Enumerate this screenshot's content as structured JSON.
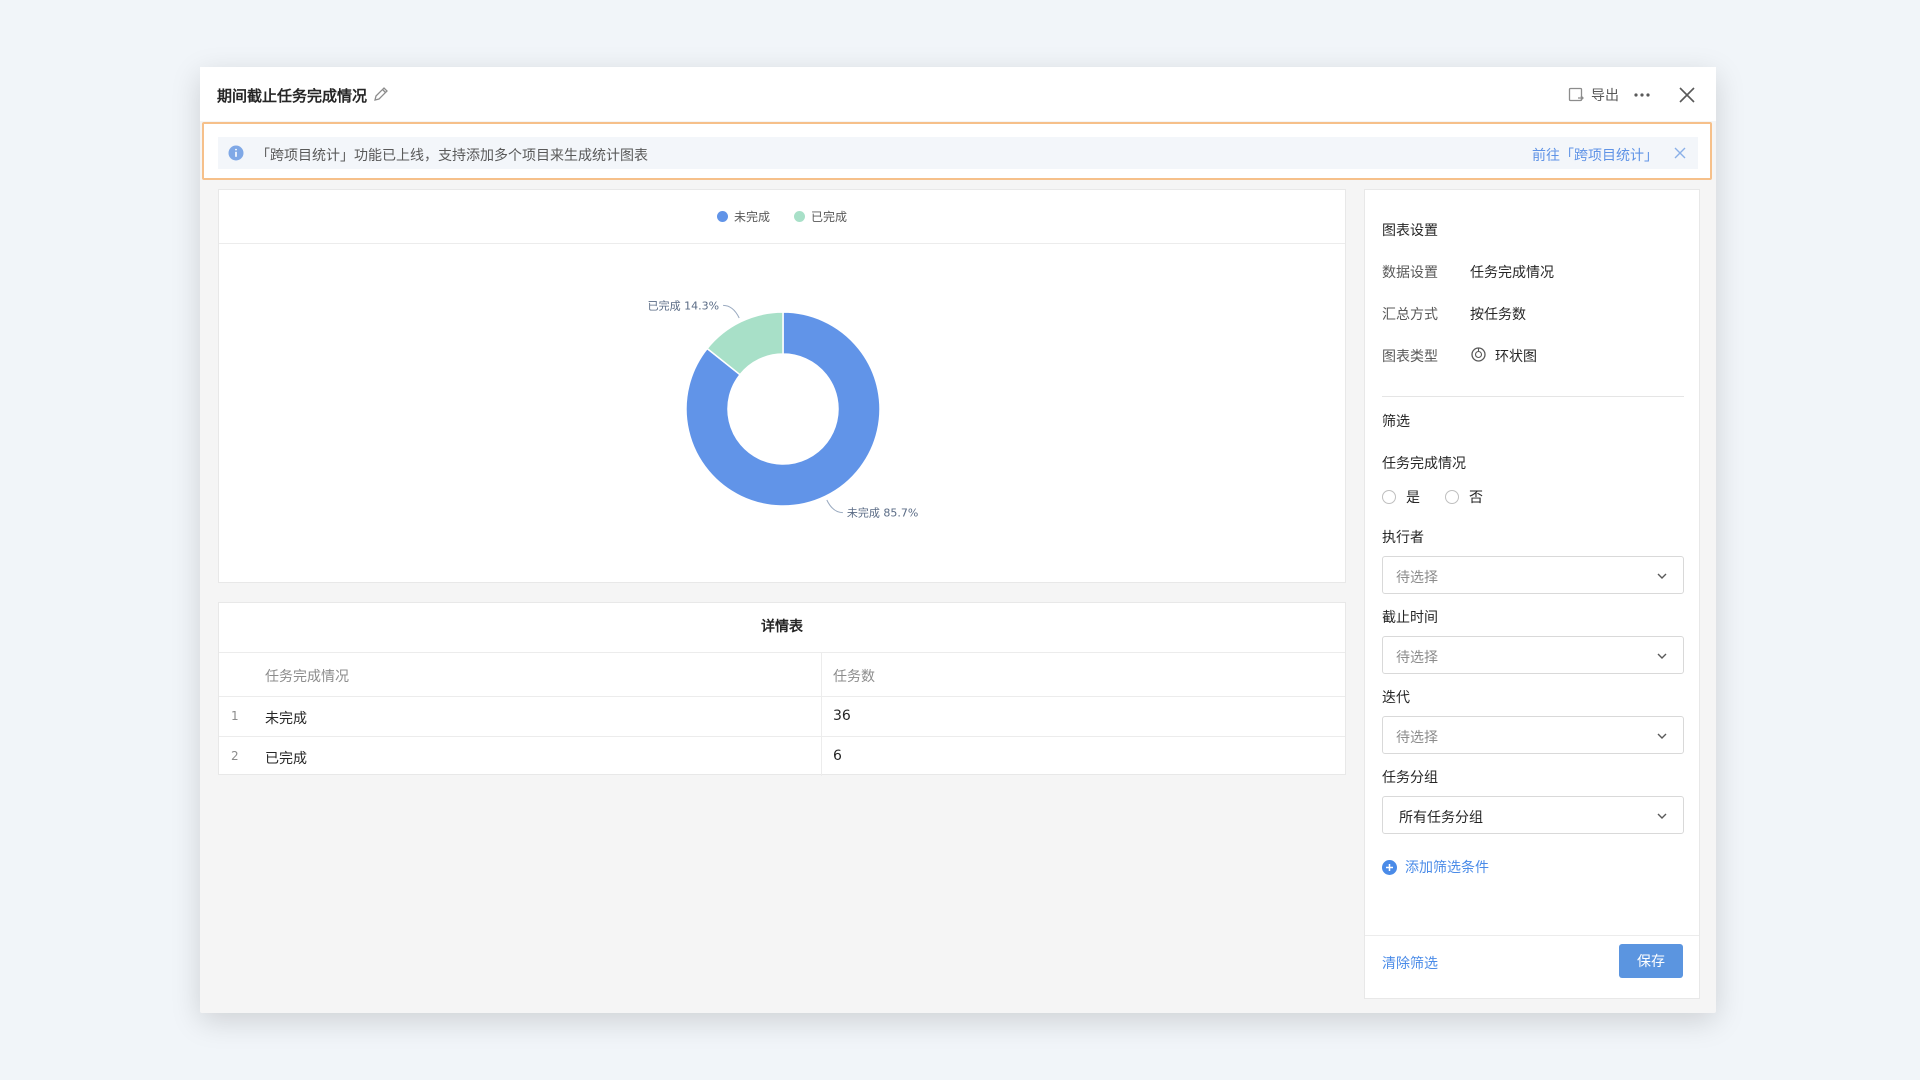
{
  "header": {
    "title": "期间截止任务完成情况",
    "export_label": "导出"
  },
  "notice": {
    "text": "「跨项目统计」功能已上线，支持添加多个项目来生成统计图表",
    "link": "前往「跨项目统计」"
  },
  "legend": {
    "items": [
      {
        "label": "未完成",
        "color": "#6194e8"
      },
      {
        "label": "已完成",
        "color": "#a8e0c8"
      }
    ]
  },
  "chart_data": {
    "type": "pie",
    "variant": "donut",
    "categories": [
      "未完成",
      "已完成"
    ],
    "values": [
      36,
      6
    ],
    "percent_labels": [
      "未完成 85.7%",
      "已完成 14.3%"
    ],
    "colors": [
      "#6194e8",
      "#a8e0c8"
    ],
    "legend_position": "top-center"
  },
  "table": {
    "title": "详情表",
    "columns": [
      "任务完成情况",
      "任务数"
    ],
    "rows": [
      {
        "index": "1",
        "status": "未完成",
        "count": "36"
      },
      {
        "index": "2",
        "status": "已完成",
        "count": "6"
      }
    ]
  },
  "settings": {
    "section_title": "图表设置",
    "data_setting_key": "数据设置",
    "data_setting_value": "任务完成情况",
    "aggregate_key": "汇总方式",
    "aggregate_value": "按任务数",
    "chart_type_key": "图表类型",
    "chart_type_value": "环状图"
  },
  "filters": {
    "section_title": "筛选",
    "completion_label": "任务完成情况",
    "yes_label": "是",
    "no_label": "否",
    "assignee_label": "执行者",
    "assignee_value": "待选择",
    "deadline_label": "截止时间",
    "deadline_value": "待选择",
    "iteration_label": "迭代",
    "iteration_value": "待选择",
    "group_label": "任务分组",
    "group_value": "所有任务分组",
    "add_filter_label": "添加筛选条件",
    "clear_label": "清除筛选",
    "save_label": "保存"
  }
}
